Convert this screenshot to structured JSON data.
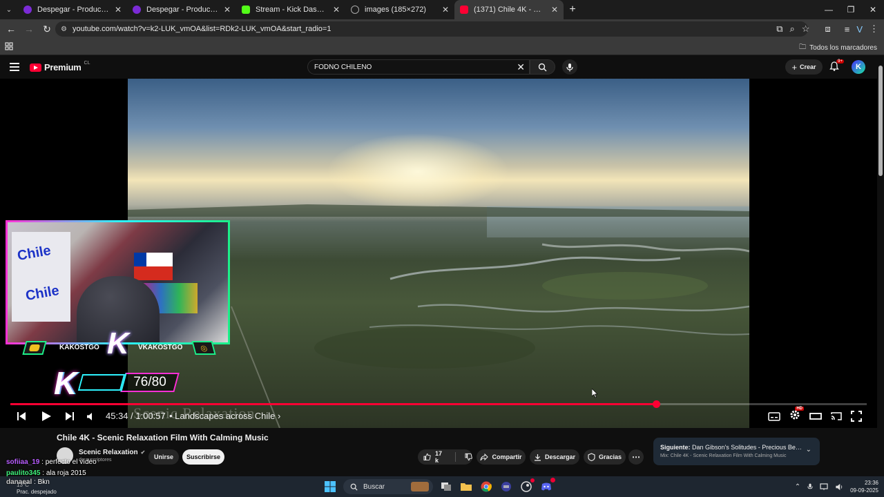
{
  "browser": {
    "tabs": [
      {
        "title": "Despegar - Productos Combina",
        "favicon_color": "#7b2bd6"
      },
      {
        "title": "Despegar - Productos combina",
        "favicon_color": "#7b2bd6"
      },
      {
        "title": "Stream - Kick Dashboard",
        "favicon_color": "#53fc18"
      },
      {
        "title": "images (185×272)",
        "favicon_color": "#8a8a8a"
      },
      {
        "title": "(1371) Chile 4K - Scenic Relaxat",
        "favicon_color": "#ff0033"
      }
    ],
    "url": "youtube.com/watch?v=k2-LUK_vmOA&list=RDk2-LUK_vmOA&start_radio=1",
    "bookmarks_all": "Todos los marcadores"
  },
  "youtube": {
    "logo_text": "Premium",
    "logo_region": "CL",
    "search_query": "FODNO CHILENO",
    "create_label": "Crear",
    "notif_badge": "9+",
    "avatar_letter": "K"
  },
  "player": {
    "progress": 0.754,
    "time": "45:34 / 1:00:57",
    "chapter": "• Landscapes across Chile ›",
    "watermark": "Scenic Relaxation",
    "hd_badge": "HD"
  },
  "stream_overlay": {
    "left_name": "KAKOSTGO",
    "right_name": "VKAKOSTGO",
    "sub_goal": "76/80",
    "sign_text": "Chile"
  },
  "video": {
    "title": "Chile 4K - Scenic Relaxation Film With Calming Music",
    "channel": "Scenic Relaxation",
    "subscribers": "de suscriptores",
    "join": "Unirse",
    "subscribe": "Suscribirse",
    "likes": "17 k",
    "share": "Compartir",
    "download": "Descargar",
    "thanks": "Gracias"
  },
  "up_next": {
    "label": "Siguiente:",
    "title": "Dan Gibson's Solitudes - Precious Beauty...",
    "mix": "Mix: Chile 4K - Scenic Relaxation Film With Calming Music"
  },
  "chat": [
    {
      "user": "sofiiaa_19",
      "message": "perfecto el vídeo"
    },
    {
      "user": "paulito345",
      "message": "ala roja 2015"
    },
    {
      "user": "danaeal",
      "message": "Bkn"
    }
  ],
  "taskbar": {
    "weather_temp": "13°C",
    "weather_desc": "Prac. despejado",
    "search": "Buscar",
    "time": "23:36",
    "date": "09-09-2025"
  }
}
